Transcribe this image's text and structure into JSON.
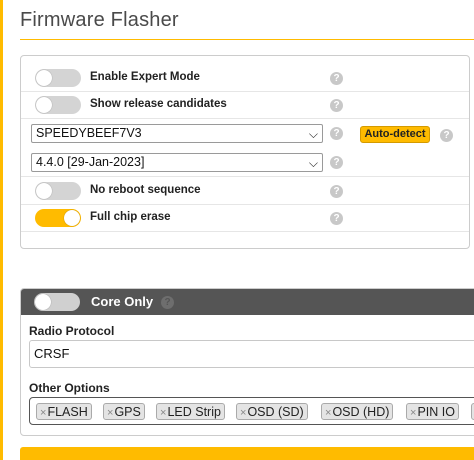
{
  "page": {
    "title": "Firmware Flasher",
    "accent_color": "#ffbb00"
  },
  "options": {
    "expert_mode": {
      "label": "Enable Expert Mode",
      "on": false
    },
    "release_candidates": {
      "label": "Show release candidates",
      "on": false
    },
    "board_select": {
      "value": "SPEEDYBEEF7V3"
    },
    "auto_detect_label": "Auto-detect",
    "version_select": {
      "value": "4.4.0 [29-Jan-2023]"
    },
    "no_reboot": {
      "label": "No reboot sequence",
      "on": false
    },
    "full_chip_erase": {
      "label": "Full chip erase",
      "on": true
    },
    "help_glyph": "?"
  },
  "core": {
    "label": "Core Only",
    "on": false,
    "radio_protocol_label": "Radio Protocol",
    "radio_protocol_value": "CRSF",
    "other_options_label": "Other Options",
    "tags": [
      "FLASH",
      "GPS",
      "LED Strip",
      "OSD (SD)",
      "OSD (HD)",
      "PIN IO",
      ""
    ],
    "tag_remove_glyph": "×"
  }
}
